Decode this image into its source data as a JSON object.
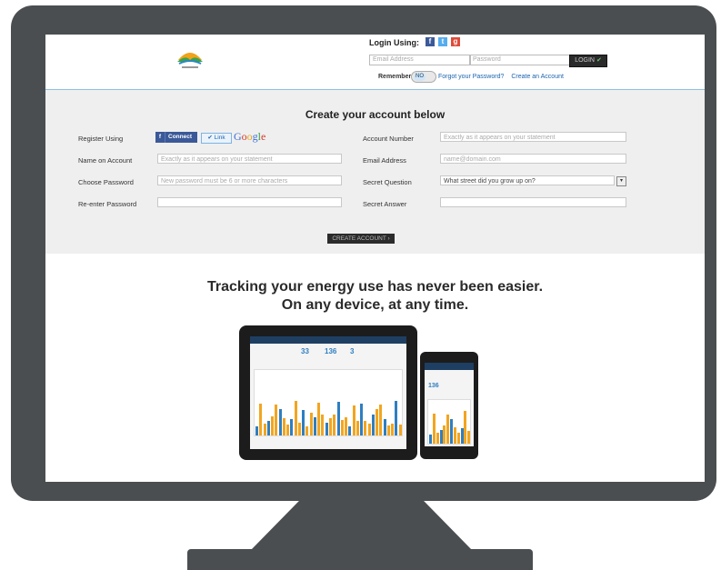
{
  "header": {
    "login_using": "Login Using:",
    "social_icons": [
      "facebook-icon",
      "twitter-icon",
      "google-icon"
    ],
    "email_placeholder": "Email Address",
    "password_placeholder": "Password",
    "login_button": "LOGIN",
    "remember_me": "Remember me",
    "toggle_value": "NO",
    "forgot_password": "Forgot your Password?",
    "create_account_link": "Create an Account"
  },
  "registration": {
    "title": "Create your account below",
    "register_using": "Register Using",
    "facebook_connect": "Connect",
    "linkedin_button": "Link",
    "google_text": [
      "G",
      "o",
      "o",
      "g",
      "l",
      "e"
    ],
    "left_fields": [
      {
        "label": "Name on Account",
        "placeholder": "Exactly as it appears on your statement"
      },
      {
        "label": "Choose Password",
        "placeholder": "New password must be 6 or more characters"
      },
      {
        "label": "Re-enter Password",
        "placeholder": ""
      }
    ],
    "right_fields": [
      {
        "label": "Account Number",
        "placeholder": "Exactly as it appears on your statement"
      },
      {
        "label": "Email Address",
        "placeholder": "name@domain.com"
      },
      {
        "label": "Secret Question",
        "value": "What street did you grow up on?"
      },
      {
        "label": "Secret Answer",
        "placeholder": ""
      }
    ],
    "create_button": "CREATE ACCOUNT"
  },
  "promo": {
    "line1": "Tracking your energy use has never been easier.",
    "line2": "On any device, at any time."
  },
  "colors": {
    "bezel": "#4b4e50",
    "panel": "#efefef",
    "accent_blue": "#2f7ec1",
    "bar_orange": "#f2a51f"
  },
  "devices": {
    "tablet_stats": [
      "33",
      "136",
      "3"
    ],
    "phone_stats": [
      "136"
    ]
  }
}
